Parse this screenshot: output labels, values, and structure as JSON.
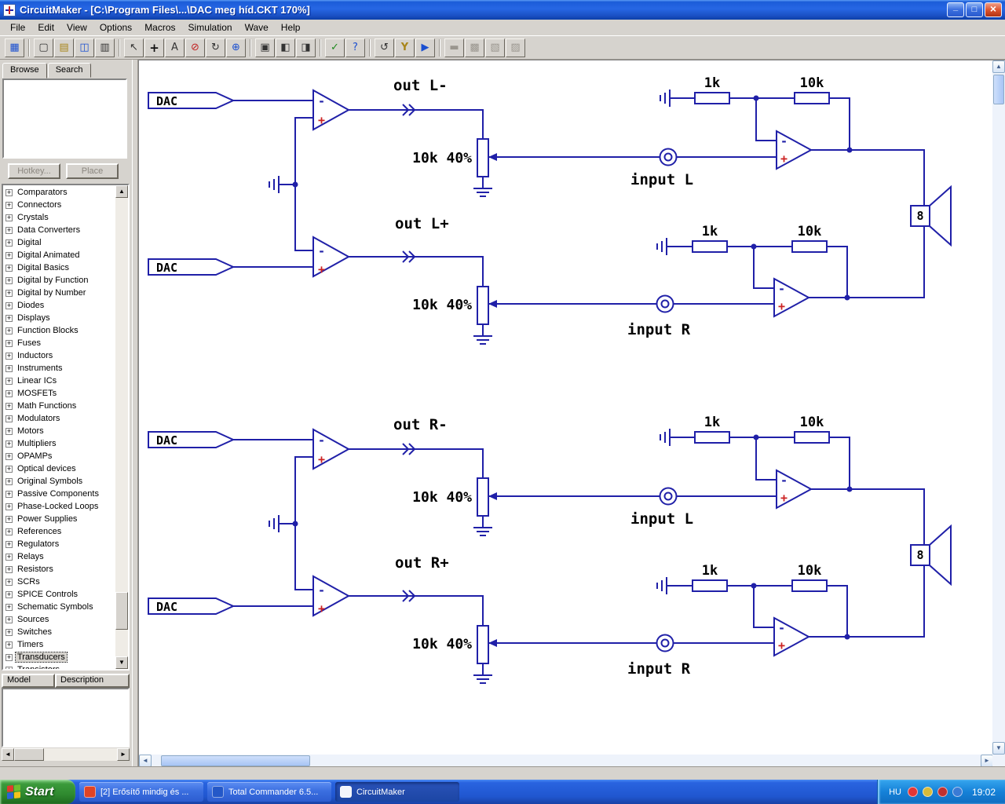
{
  "window": {
    "title": "CircuitMaker - [C:\\Program Files\\...\\DAC meg híd.CKT 170%]"
  },
  "menu": {
    "items": [
      "File",
      "Edit",
      "View",
      "Options",
      "Macros",
      "Simulation",
      "Wave",
      "Help"
    ]
  },
  "toolbar": {
    "groups": [
      [
        {
          "name": "part-browser",
          "glyph": "▦",
          "state": "c-blue"
        }
      ],
      [
        {
          "name": "new-document",
          "glyph": "▢"
        },
        {
          "name": "open-document",
          "glyph": "▤",
          "state": "c-yellow"
        },
        {
          "name": "save-document",
          "glyph": "◫",
          "state": "c-blue"
        },
        {
          "name": "print",
          "glyph": "▥"
        }
      ],
      [
        {
          "name": "arrow-tool",
          "glyph": "↖"
        },
        {
          "name": "wire-tool",
          "glyph": "+",
          "state": "c-bold"
        },
        {
          "name": "text-tool",
          "glyph": "A"
        },
        {
          "name": "delete-tool",
          "glyph": "⊘",
          "state": "c-red"
        },
        {
          "name": "rotate-tool",
          "glyph": "↻"
        },
        {
          "name": "zoom-tool",
          "glyph": "⊕",
          "state": "c-blue"
        }
      ],
      [
        {
          "name": "fit-page",
          "glyph": "▣"
        },
        {
          "name": "fit-selection",
          "glyph": "◧"
        },
        {
          "name": "split-view",
          "glyph": "◨"
        }
      ],
      [
        {
          "name": "digital-analog-toggle",
          "glyph": "✓",
          "state": "c-green"
        },
        {
          "name": "help",
          "glyph": "?",
          "state": "c-blue"
        }
      ],
      [
        {
          "name": "reset-simulation",
          "glyph": "↺"
        },
        {
          "name": "probe-tool",
          "glyph": "Y",
          "state": "c-yellow"
        },
        {
          "name": "run-simulation",
          "glyph": "▶",
          "state": "c-blue"
        }
      ],
      [
        {
          "name": "new-window",
          "glyph": "▬",
          "state": "disabled"
        },
        {
          "name": "cascade-windows",
          "glyph": "▩",
          "state": "disabled"
        },
        {
          "name": "tile-horizontal",
          "glyph": "▧",
          "state": "disabled"
        },
        {
          "name": "tile-vertical",
          "glyph": "▨",
          "state": "disabled"
        }
      ]
    ]
  },
  "sidebar": {
    "tabs": [
      "Browse",
      "Search"
    ],
    "hotkey_button": "Hotkey...",
    "place_button": "Place",
    "selected_item": "Transducers",
    "tree": [
      "Comparators",
      "Connectors",
      "Crystals",
      "Data Converters",
      "Digital",
      "Digital Animated",
      "Digital Basics",
      "Digital by Function",
      "Digital by Number",
      "Diodes",
      "Displays",
      "Function Blocks",
      "Fuses",
      "Inductors",
      "Instruments",
      "Linear ICs",
      "MOSFETs",
      "Math Functions",
      "Modulators",
      "Motors",
      "Multipliers",
      "OPAMPs",
      "Optical devices",
      "Original Symbols",
      "Passive Components",
      "Phase-Locked Loops",
      "Power Supplies",
      "References",
      "Regulators",
      "Relays",
      "Resistors",
      "SCRs",
      "SPICE Controls",
      "Schematic Symbols",
      "Sources",
      "Switches",
      "Timers",
      "Transducers",
      "Transistors"
    ],
    "model_tab": "Model",
    "description_tab": "Description"
  },
  "schematic": {
    "dac_label": "DAC",
    "pot_label": "10k 40%",
    "r1_label": "1k",
    "r2_label": "10k",
    "input_top_label": "input L",
    "input_bottom_label": "input R",
    "speaker_label": "8",
    "minus_sign": "-",
    "plus_sign": "+",
    "outputs": [
      "out L-",
      "out L+",
      "out R-",
      "out R+"
    ]
  },
  "taskbar": {
    "start_label": "Start",
    "tasks": [
      {
        "label": "[2] Erősítő mindig és ...",
        "icon": "#e04326"
      },
      {
        "label": "Total Commander 6.5...",
        "icon": "#2458c8"
      },
      {
        "label": "CircuitMaker",
        "icon": "#f4f6fb",
        "state": "active"
      }
    ],
    "tray": {
      "language": "HU",
      "icons": [
        {
          "name": "security-alert-icon",
          "color": "#e23636"
        },
        {
          "name": "volume-icon",
          "color": "#d8bb3a"
        },
        {
          "name": "antivirus-icon",
          "color": "#c03030"
        },
        {
          "name": "display-icon",
          "color": "#3a7bd5"
        }
      ],
      "time": "19:02"
    }
  }
}
